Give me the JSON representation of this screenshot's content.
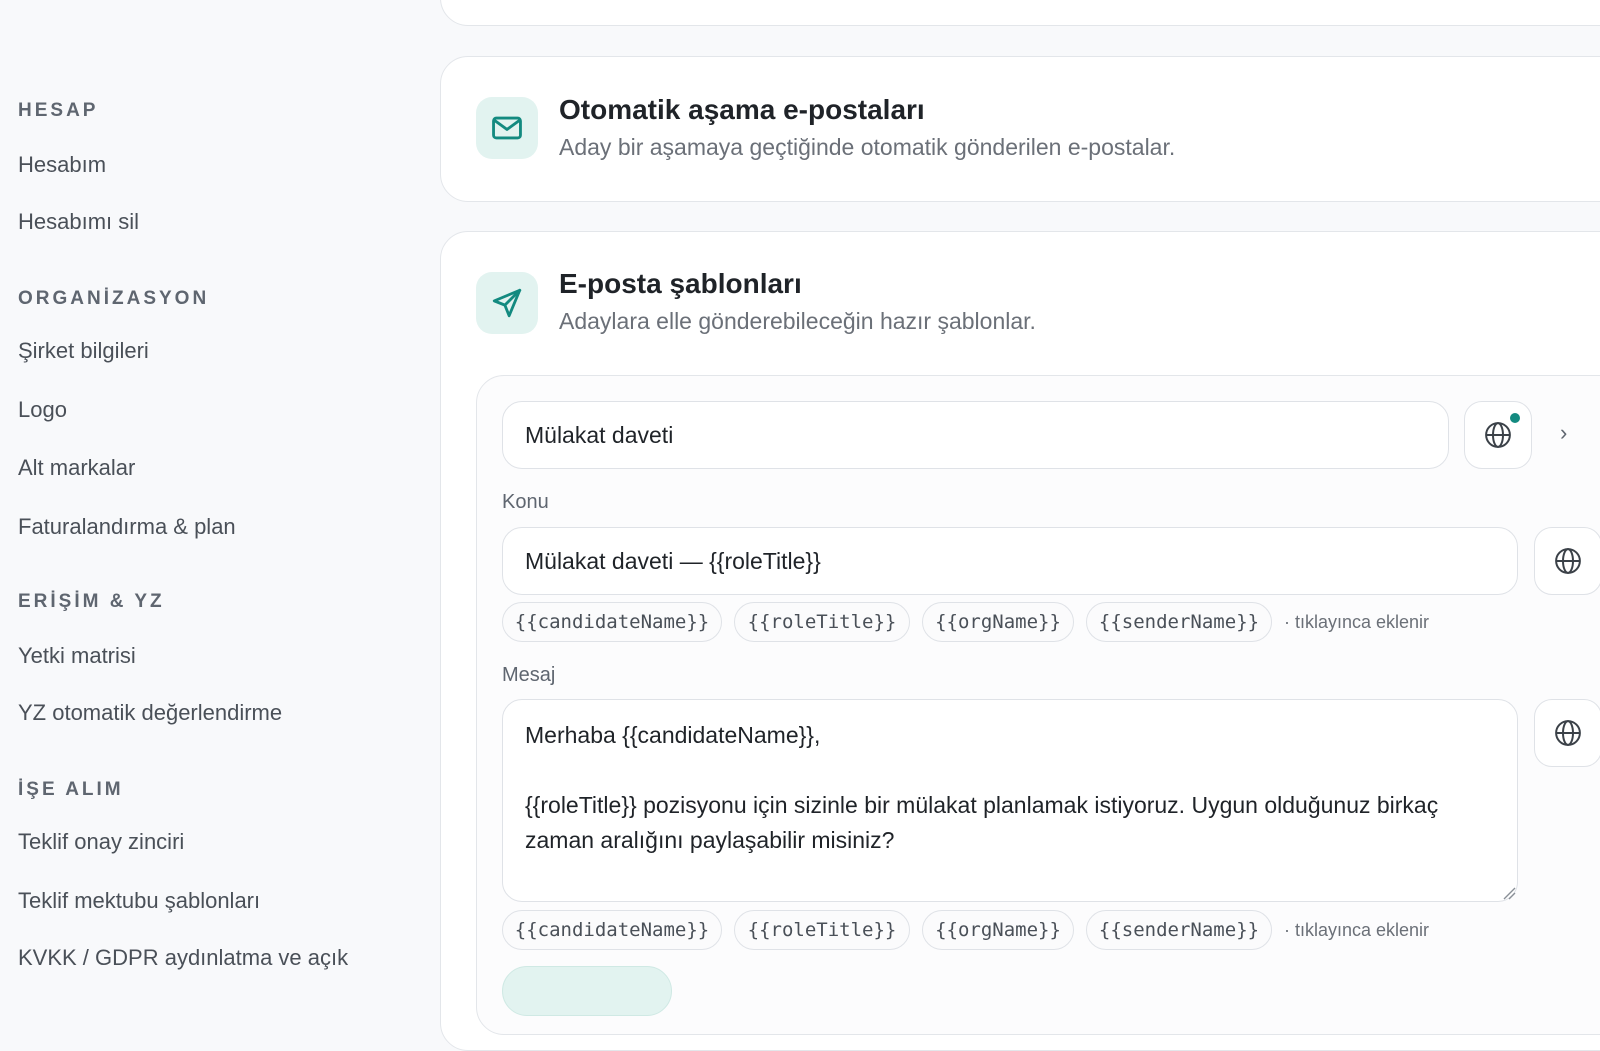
{
  "sidebar": {
    "sections": [
      {
        "title": "HESAP",
        "items": [
          "Hesabım",
          "Hesabımı sil"
        ]
      },
      {
        "title": "ORGANİZASYON",
        "items": [
          "Şirket bilgileri",
          "Logo",
          "Alt markalar",
          "Faturalandırma & plan"
        ]
      },
      {
        "title": "ERİŞİM & YZ",
        "items": [
          "Yetki matrisi",
          "YZ otomatik değerlendirme"
        ]
      },
      {
        "title": "İŞE ALIM",
        "items": [
          "Teklif onay zinciri",
          "Teklif mektubu şablonları",
          "KVKK / GDPR aydınlatma ve açık"
        ]
      }
    ]
  },
  "auto_emails": {
    "icon": "mail-icon",
    "title": "Otomatik aşama e-postaları",
    "subtitle": "Aday bir aşamaya geçtiğinde otomatik gönderilen e-postalar."
  },
  "templates": {
    "icon": "send-icon",
    "title": "E-posta şablonları",
    "subtitle": "Adaylara elle gönderebileceğin hazır şablonlar.",
    "name_value": "Mülakat daveti",
    "subject_label": "Konu",
    "subject_value": "Mülakat daveti — {{roleTitle}}",
    "message_label": "Mesaj",
    "message_value": "Merhaba {{candidateName}},\n\n{{roleTitle}} pozisyonu için sizinle bir mülakat planlamak istiyoruz. Uygun olduğunuz birkaç zaman aralığını paylaşabilir misiniz?\n\nSaygılarımızla,",
    "chips": [
      "{{candidateName}}",
      "{{roleTitle}}",
      "{{orgName}}",
      "{{senderName}}"
    ],
    "chip_hint": "· tıklayınca eklenir"
  },
  "colors": {
    "accent": "#138a80",
    "icon_bg": "#e2f3f0"
  }
}
